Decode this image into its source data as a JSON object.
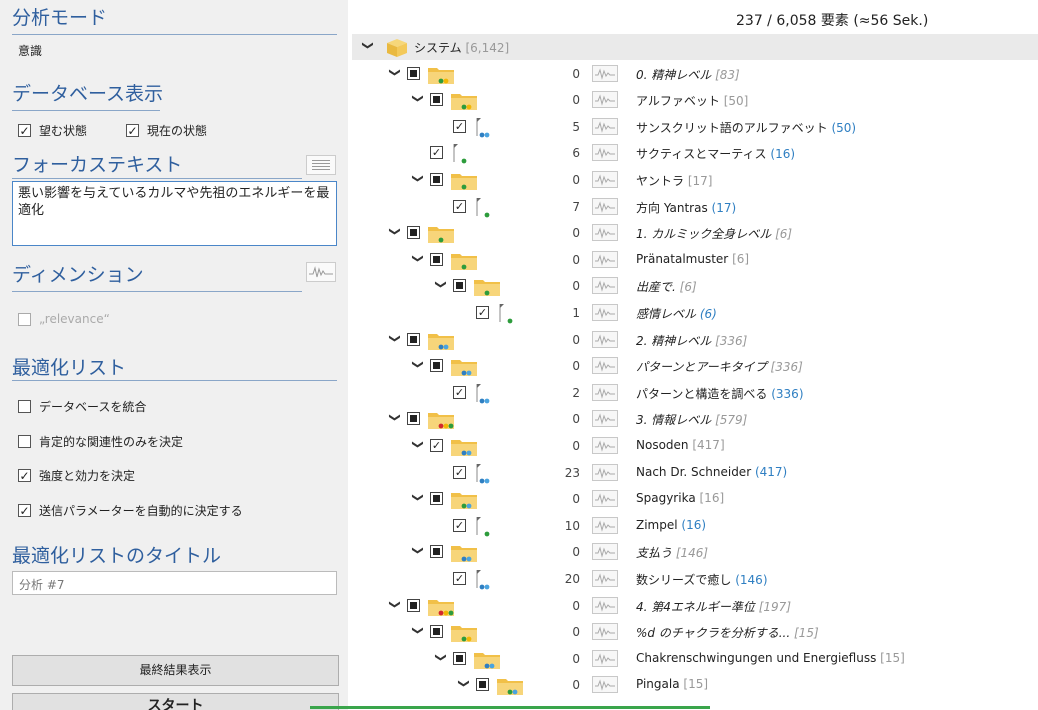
{
  "left": {
    "analysis_mode": {
      "title": "分析モード",
      "value": "意識"
    },
    "db_display": {
      "title": "データベース表示",
      "options": [
        {
          "label": "望む状態",
          "checked": true
        },
        {
          "label": "現在の状態",
          "checked": true
        }
      ]
    },
    "focus_text": {
      "title": "フォーカステキスト",
      "value": "悪い影響を与えているカルマや先祖のエネルギーを最適化"
    },
    "dimension": {
      "title": "ディメンション",
      "option": {
        "label": "„relevance“",
        "checked": false
      }
    },
    "opt_list": {
      "title": "最適化リスト",
      "options": [
        {
          "label": "データベースを統合",
          "checked": false
        },
        {
          "label": "肯定的な関連性のみを決定",
          "checked": false
        },
        {
          "label": "強度と効力を決定",
          "checked": true
        },
        {
          "label": "送信パラメーターを自動的に決定する",
          "checked": true
        }
      ]
    },
    "opt_list_title": {
      "title": "最適化リストのタイトル",
      "placeholder": "分析 #7"
    },
    "buttons": {
      "final_results": "最終結果表示",
      "start": "スタート"
    }
  },
  "header": {
    "count": "237 / 6,058 要素 (≈56 Sek.)"
  },
  "tree": [
    {
      "level": 0,
      "kind": "root",
      "name": "システム",
      "bracket": "[6,142]",
      "count": "",
      "italic": false,
      "blue": false,
      "state": "none",
      "dots": []
    },
    {
      "level": 1,
      "kind": "folder",
      "name": "0. 精神レベル",
      "bracket": "[83]",
      "count": "0",
      "italic": true,
      "blue": false,
      "state": "part",
      "dots": [
        "#2d9c3c",
        "#f2b705"
      ]
    },
    {
      "level": 2,
      "kind": "folder",
      "name": "アルファベット",
      "bracket": "[50]",
      "count": "0",
      "italic": false,
      "blue": false,
      "state": "part",
      "dots": [
        "#2d9c3c",
        "#f2b705"
      ]
    },
    {
      "level": 3,
      "kind": "leaf",
      "name": "サンスクリット語のアルファベット",
      "bracket": "(50)",
      "count": "5",
      "italic": false,
      "blue": true,
      "state": "check",
      "dots": [
        "#2f7fc2",
        "#4aa3df"
      ]
    },
    {
      "level": 2,
      "kind": "leaf",
      "name": "サクティスとマーティス",
      "bracket": "(16)",
      "count": "6",
      "italic": false,
      "blue": true,
      "state": "check",
      "dots": [
        "#2d9c3c"
      ]
    },
    {
      "level": 2,
      "kind": "folder",
      "name": "ヤントラ",
      "bracket": "[17]",
      "count": "0",
      "italic": false,
      "blue": false,
      "state": "part",
      "dots": [
        "#2d9c3c"
      ]
    },
    {
      "level": 3,
      "kind": "leaf",
      "name": "方向 Yantras",
      "bracket": "(17)",
      "count": "7",
      "italic": false,
      "blue": true,
      "state": "check",
      "dots": [
        "#2d9c3c"
      ]
    },
    {
      "level": 1,
      "kind": "folder",
      "name": "1. カルミック全身レベル",
      "bracket": "[6]",
      "count": "0",
      "italic": true,
      "blue": false,
      "state": "part",
      "dots": [
        "#2d9c3c"
      ]
    },
    {
      "level": 2,
      "kind": "folder",
      "name": "Pränatalmuster",
      "bracket": "[6]",
      "count": "0",
      "italic": false,
      "blue": false,
      "state": "part",
      "dots": [
        "#2d9c3c"
      ]
    },
    {
      "level": 3,
      "kind": "folder",
      "name": "出産で.",
      "bracket": "[6]",
      "count": "0",
      "italic": true,
      "blue": false,
      "state": "part",
      "dots": [
        "#2d9c3c"
      ]
    },
    {
      "level": 4,
      "kind": "leaf",
      "name": "感情レベル",
      "bracket": "(6)",
      "count": "1",
      "italic": true,
      "blue": true,
      "state": "check",
      "dots": [
        "#2d9c3c"
      ]
    },
    {
      "level": 1,
      "kind": "folder",
      "name": "2. 精神レベル",
      "bracket": "[336]",
      "count": "0",
      "italic": true,
      "blue": false,
      "state": "part",
      "dots": [
        "#2f7fc2",
        "#4aa3df"
      ]
    },
    {
      "level": 2,
      "kind": "folder",
      "name": "パターンとアーキタイプ",
      "bracket": "[336]",
      "count": "0",
      "italic": true,
      "blue": false,
      "state": "part",
      "dots": [
        "#2f7fc2",
        "#4aa3df"
      ]
    },
    {
      "level": 3,
      "kind": "leaf",
      "name": "パターンと構造を調べる",
      "bracket": "(336)",
      "count": "2",
      "italic": false,
      "blue": true,
      "state": "check",
      "dots": [
        "#2f7fc2",
        "#4aa3df"
      ]
    },
    {
      "level": 1,
      "kind": "folder",
      "name": "3. 情報レベル",
      "bracket": "[579]",
      "count": "0",
      "italic": true,
      "blue": false,
      "state": "part",
      "dots": [
        "#d4282e",
        "#f2b705",
        "#2d9c3c"
      ]
    },
    {
      "level": 2,
      "kind": "folder",
      "name": "Nosoden",
      "bracket": "[417]",
      "count": "0",
      "italic": false,
      "blue": false,
      "state": "check",
      "dots": [
        "#2f7fc2",
        "#4aa3df"
      ]
    },
    {
      "level": 3,
      "kind": "leaf",
      "name": "Nach Dr. Schneider",
      "bracket": "(417)",
      "count": "23",
      "italic": false,
      "blue": true,
      "state": "check",
      "dots": [
        "#2f7fc2",
        "#4aa3df"
      ]
    },
    {
      "level": 2,
      "kind": "folder",
      "name": "Spagyrika",
      "bracket": "[16]",
      "count": "0",
      "italic": false,
      "blue": false,
      "state": "part",
      "dots": [
        "#2d9c3c",
        "#4aa3df"
      ]
    },
    {
      "level": 3,
      "kind": "leaf",
      "name": "Zimpel",
      "bracket": "(16)",
      "count": "10",
      "italic": false,
      "blue": true,
      "state": "check",
      "dots": [
        "#2d9c3c"
      ]
    },
    {
      "level": 2,
      "kind": "folder",
      "name": "支払う",
      "bracket": "[146]",
      "count": "0",
      "italic": true,
      "blue": false,
      "state": "part",
      "dots": [
        "#2f7fc2",
        "#4aa3df"
      ]
    },
    {
      "level": 3,
      "kind": "leaf",
      "name": "数シリーズで癒し",
      "bracket": "(146)",
      "count": "20",
      "italic": false,
      "blue": true,
      "state": "check",
      "dots": [
        "#2f7fc2",
        "#4aa3df"
      ]
    },
    {
      "level": 1,
      "kind": "folder",
      "name": "4. 第4エネルギー準位",
      "bracket": "[197]",
      "count": "0",
      "italic": true,
      "blue": false,
      "state": "part",
      "dots": [
        "#d4282e",
        "#f2b705",
        "#2d9c3c"
      ]
    },
    {
      "level": 2,
      "kind": "folder",
      "name": "%d のチャクラを分析する...",
      "bracket": "[15]",
      "count": "0",
      "italic": true,
      "blue": false,
      "state": "part",
      "dots": [
        "#2d9c3c",
        "#f2b705"
      ]
    },
    {
      "level": 3,
      "kind": "folder",
      "name": "Chakrenschwingungen und Energiefluss",
      "bracket": "[15]",
      "count": "0",
      "italic": false,
      "blue": false,
      "state": "part",
      "dots": [
        "#2f7fc2",
        "#4aa3df"
      ]
    },
    {
      "level": 4,
      "kind": "folder",
      "name": "Pingala",
      "bracket": "[15]",
      "count": "0",
      "italic": false,
      "blue": false,
      "state": "part",
      "dots": [
        "#2d9c3c",
        "#4aa3df"
      ]
    }
  ]
}
